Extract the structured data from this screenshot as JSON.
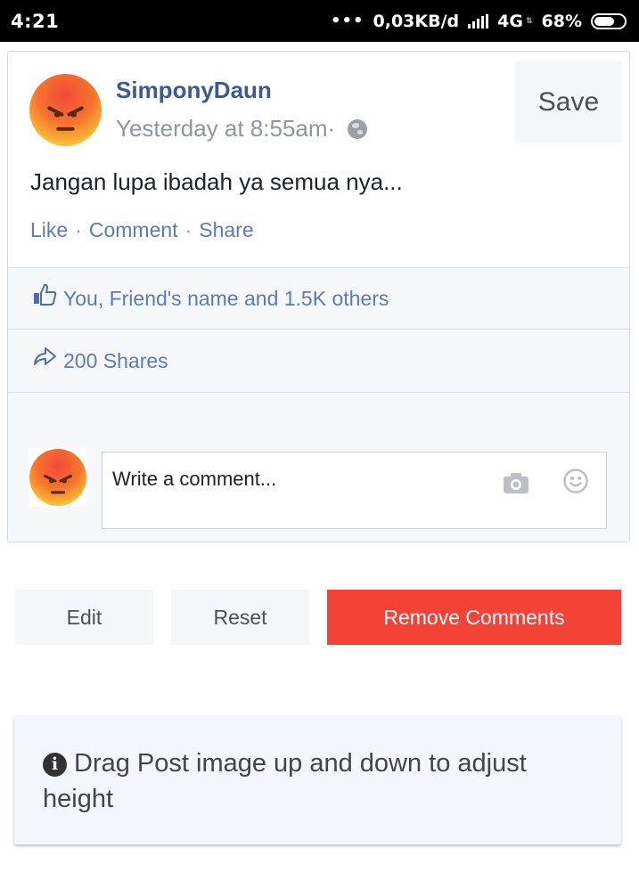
{
  "status_bar": {
    "time": "4:21",
    "dots": "•••",
    "network_speed": "0,03KB/d",
    "network_type": "4G",
    "battery": "68%"
  },
  "post": {
    "author": "SimponyDaun",
    "timestamp": "Yesterday at 8:55am·",
    "text": "Jangan lupa ibadah ya semua nya...",
    "save_label": "Save",
    "actions": {
      "like": "Like",
      "comment": "Comment",
      "share": "Share",
      "separator": "·"
    },
    "likes_text": "You, Friend's name and 1.5K others",
    "shares_text": "200 Shares",
    "comment_placeholder": "Write a comment...",
    "privacy_icon": "globe-icon",
    "avatar_icon": "angry-face-icon"
  },
  "buttons": {
    "edit": "Edit",
    "reset": "Reset",
    "remove_comments": "Remove Comments"
  },
  "info": {
    "icon_glyph": "i",
    "text": "Drag Post image up and down to adjust height"
  },
  "colors": {
    "link_blue": "#3b5998",
    "action_blue": "#5b7bb3",
    "remove_red": "#f44336",
    "info_bg": "#f1f7fc"
  }
}
